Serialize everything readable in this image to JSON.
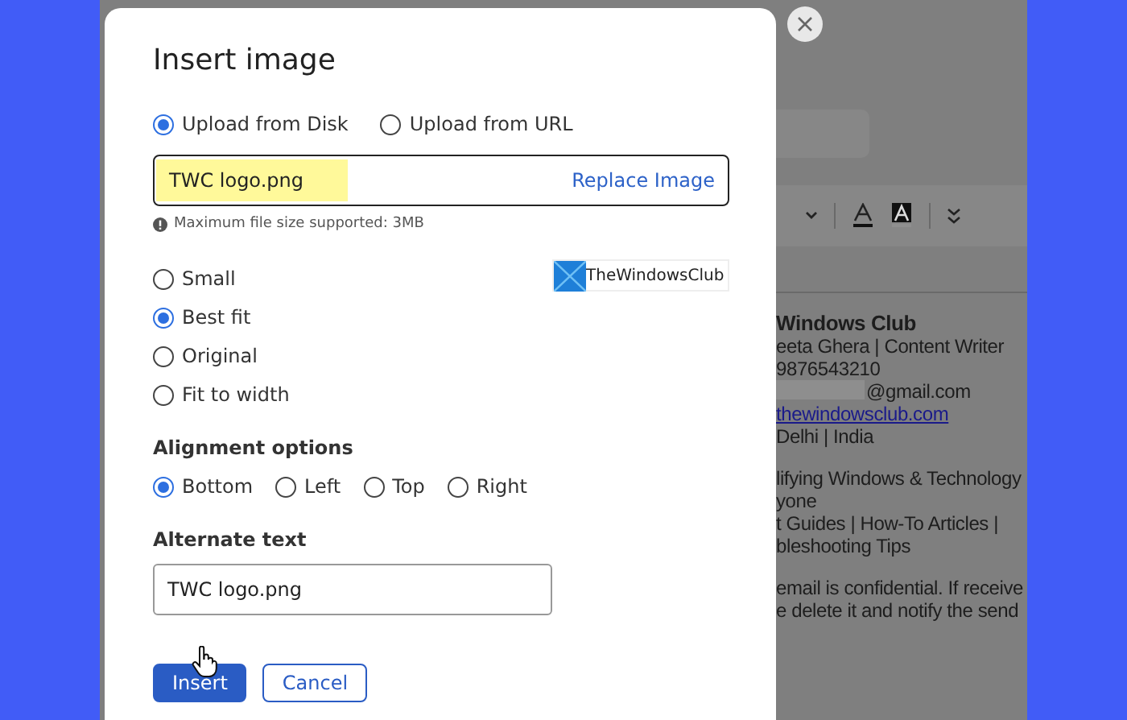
{
  "background": {
    "toolbar": {
      "items": [
        {
          "kind": "caret"
        },
        {
          "kind": "separator"
        },
        {
          "kind": "text-color"
        },
        {
          "kind": "highlight-color"
        },
        {
          "kind": "separator"
        },
        {
          "kind": "more"
        }
      ]
    },
    "signature_paragraphs": [
      [
        {
          "text": "Windows Club",
          "kind": "bold"
        },
        {
          "text": "eeta Ghera | Content Writer",
          "kind": "plain"
        },
        {
          "text": "9876543210",
          "kind": "plain"
        },
        {
          "text": "@gmail.com",
          "kind": "redacted"
        },
        {
          "text": "thewindowsclub.com",
          "kind": "link"
        },
        {
          "text": "Delhi | India",
          "kind": "plain"
        }
      ],
      [
        {
          "text": "lifying Windows & Technology",
          "kind": "plain"
        },
        {
          "text": "yone",
          "kind": "plain"
        },
        {
          "text": "t Guides | How-To Articles |",
          "kind": "plain"
        },
        {
          "text": "bleshooting Tips",
          "kind": "plain"
        }
      ],
      [
        {
          "text": "email is confidential. If receive",
          "kind": "plain"
        },
        {
          "text": "e delete it and notify the send",
          "kind": "plain"
        }
      ]
    ]
  },
  "dialog": {
    "title": "Insert image",
    "source_options": [
      {
        "label": "Upload from Disk",
        "selected": true
      },
      {
        "label": "Upload from URL",
        "selected": false
      }
    ],
    "file": {
      "name": "TWC logo.png",
      "action": "Replace Image"
    },
    "hint": "Maximum file size supported: 3MB",
    "size_options": [
      {
        "label": "Small",
        "selected": false
      },
      {
        "label": "Best fit",
        "selected": true
      },
      {
        "label": "Original",
        "selected": false
      },
      {
        "label": "Fit to width",
        "selected": false
      }
    ],
    "preview": {
      "logo_text": "TheWindowsClub"
    },
    "alignment": {
      "label": "Alignment options",
      "options": [
        {
          "label": "Bottom",
          "selected": true
        },
        {
          "label": "Left",
          "selected": false
        },
        {
          "label": "Top",
          "selected": false
        },
        {
          "label": "Right",
          "selected": false
        }
      ]
    },
    "alt_text": {
      "label": "Alternate text",
      "value": "TWC logo.png"
    },
    "buttons": [
      {
        "label": "Insert",
        "kind": "primary"
      },
      {
        "label": "Cancel",
        "kind": "secondary"
      }
    ]
  }
}
